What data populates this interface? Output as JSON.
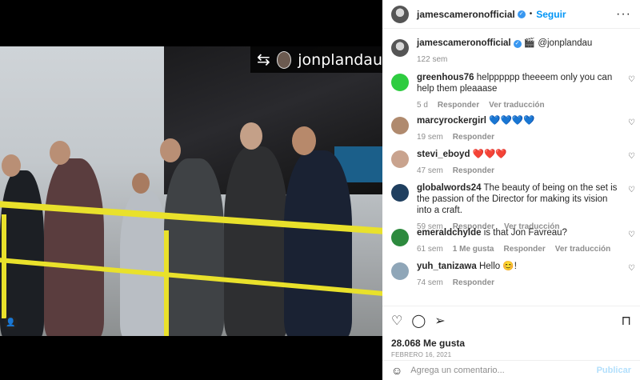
{
  "media": {
    "repost_badge_name": "jonplandau",
    "repost_icon": "repost-icon"
  },
  "header": {
    "username": "jamescameronofficial",
    "separator": "•",
    "follow_label": "Seguir",
    "more_label": "···"
  },
  "caption": {
    "username": "jamescameronofficial",
    "text": "🎬 @jonplandau",
    "time": "122 sem"
  },
  "comments": [
    {
      "username": "greenhous76",
      "text": "helpppppp theeeem only you can help them pleaaase",
      "time": "5 d",
      "reply": "Responder",
      "translate": "Ver traducción",
      "avatar_color": "#2ecc40"
    },
    {
      "username": "marcyrockergirl",
      "text": "💙💙💙💙",
      "time": "19 sem",
      "reply": "Responder",
      "avatar_color": "#b08a6e"
    },
    {
      "username": "stevi_eboyd",
      "text": "❤️❤️❤️",
      "time": "47 sem",
      "reply": "Responder",
      "avatar_color": "#c9a38e"
    },
    {
      "username": "globalwords24",
      "text": "The beauty of being on the set is the passion of the Director for making its vision into a craft.",
      "time": "59 sem",
      "reply": "Responder",
      "translate": "Ver traducción",
      "avatar_color": "#1f3f5f"
    },
    {
      "username": "emeraldchylde",
      "text": "is that Jon Favreau?",
      "time": "61 sem",
      "likes": "1 Me gusta",
      "reply": "Responder",
      "translate": "Ver traducción",
      "avatar_color": "#2d8a3e"
    },
    {
      "username": "yuh_tanizawa",
      "text": "Hello 😊!",
      "time": "74 sem",
      "reply": "Responder",
      "avatar_color": "#8fa6b8"
    }
  ],
  "actions": {
    "likes": "28.068 Me gusta",
    "date": "FEBRERO 16, 2021"
  },
  "add_comment": {
    "placeholder": "Agrega un comentario...",
    "post_label": "Publicar"
  }
}
